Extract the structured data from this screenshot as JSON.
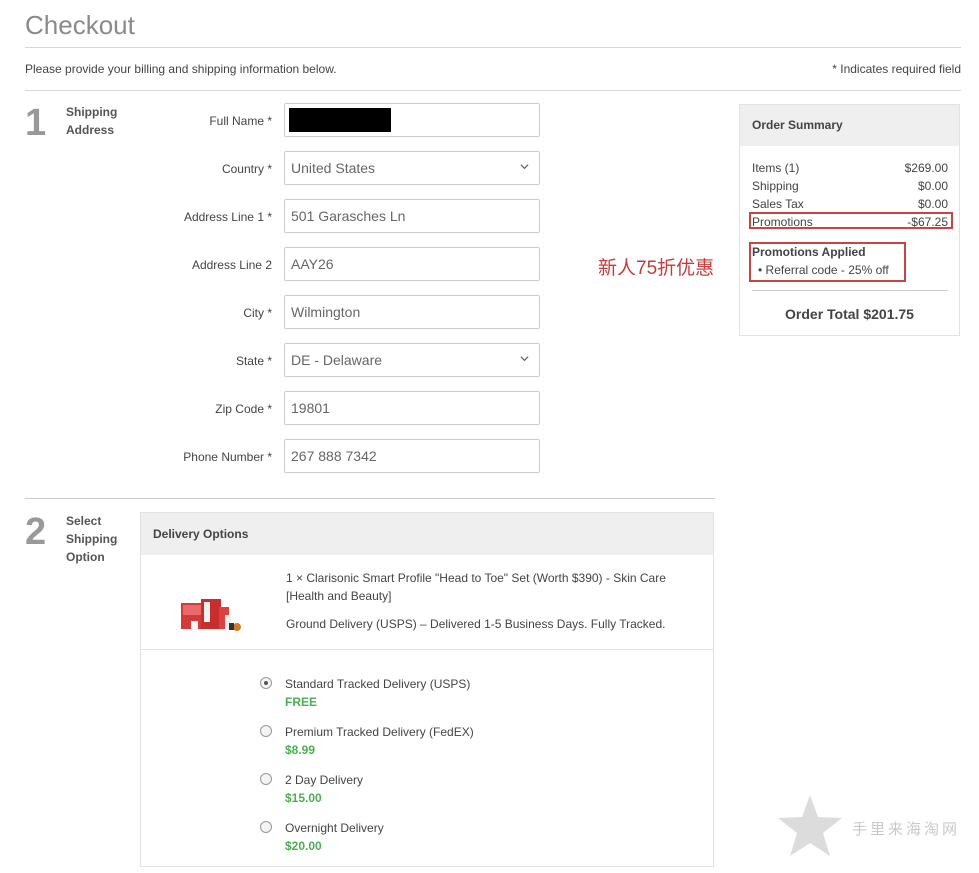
{
  "page": {
    "title": "Checkout",
    "intro": "Please provide your billing and shipping information below.",
    "required_note": "* Indicates required field"
  },
  "step1": {
    "number": "1",
    "label": [
      "Shipping",
      "Address"
    ],
    "fields": [
      {
        "label": "Full Name *",
        "value": "",
        "redacted": true
      },
      {
        "label": "Country *",
        "value": "United States",
        "type": "select"
      },
      {
        "label": "Address Line 1 *",
        "value": "501 Garasches Ln"
      },
      {
        "label": "Address Line 2",
        "value": "AAY26"
      },
      {
        "label": "City *",
        "value": "Wilmington"
      },
      {
        "label": "State *",
        "value": "DE - Delaware",
        "type": "select"
      },
      {
        "label": "Zip Code *",
        "value": "19801"
      },
      {
        "label": "Phone Number *",
        "value": "267 888 7342"
      }
    ]
  },
  "annotation": "新人75折优惠",
  "summary": {
    "title": "Order Summary",
    "rows": [
      {
        "label": "Items (1)",
        "value": "$269.00"
      },
      {
        "label": "Shipping",
        "value": "$0.00"
      },
      {
        "label": "Sales Tax",
        "value": "$0.00"
      },
      {
        "label": "Promotions",
        "value": "-$67.25"
      }
    ],
    "applied_title": "Promotions Applied",
    "applied_item": "Referral code - 25% off",
    "total": "Order Total $201.75"
  },
  "step2": {
    "number": "2",
    "label": [
      "Select",
      "Shipping",
      "Option"
    ],
    "box_title": "Delivery Options",
    "product_name": "1 × Clarisonic Smart Profile \"Head to Toe\" Set (Worth $390) - Skin Care [Health and Beauty]",
    "product_shipping": "Ground Delivery (USPS) – Delivered 1-5 Business Days. Fully Tracked.",
    "options": [
      {
        "name": "Standard Tracked Delivery (USPS)",
        "price": "FREE",
        "selected": true
      },
      {
        "name": "Premium Tracked Delivery (FedEX)",
        "price": "$8.99",
        "selected": false
      },
      {
        "name": "2 Day Delivery",
        "price": "$15.00",
        "selected": false
      },
      {
        "name": "Overnight Delivery",
        "price": "$20.00",
        "selected": false
      }
    ]
  },
  "colors": {
    "accent_red": "#c64545",
    "price_green": "#4caf50"
  },
  "watermark": "手里来海淘网"
}
